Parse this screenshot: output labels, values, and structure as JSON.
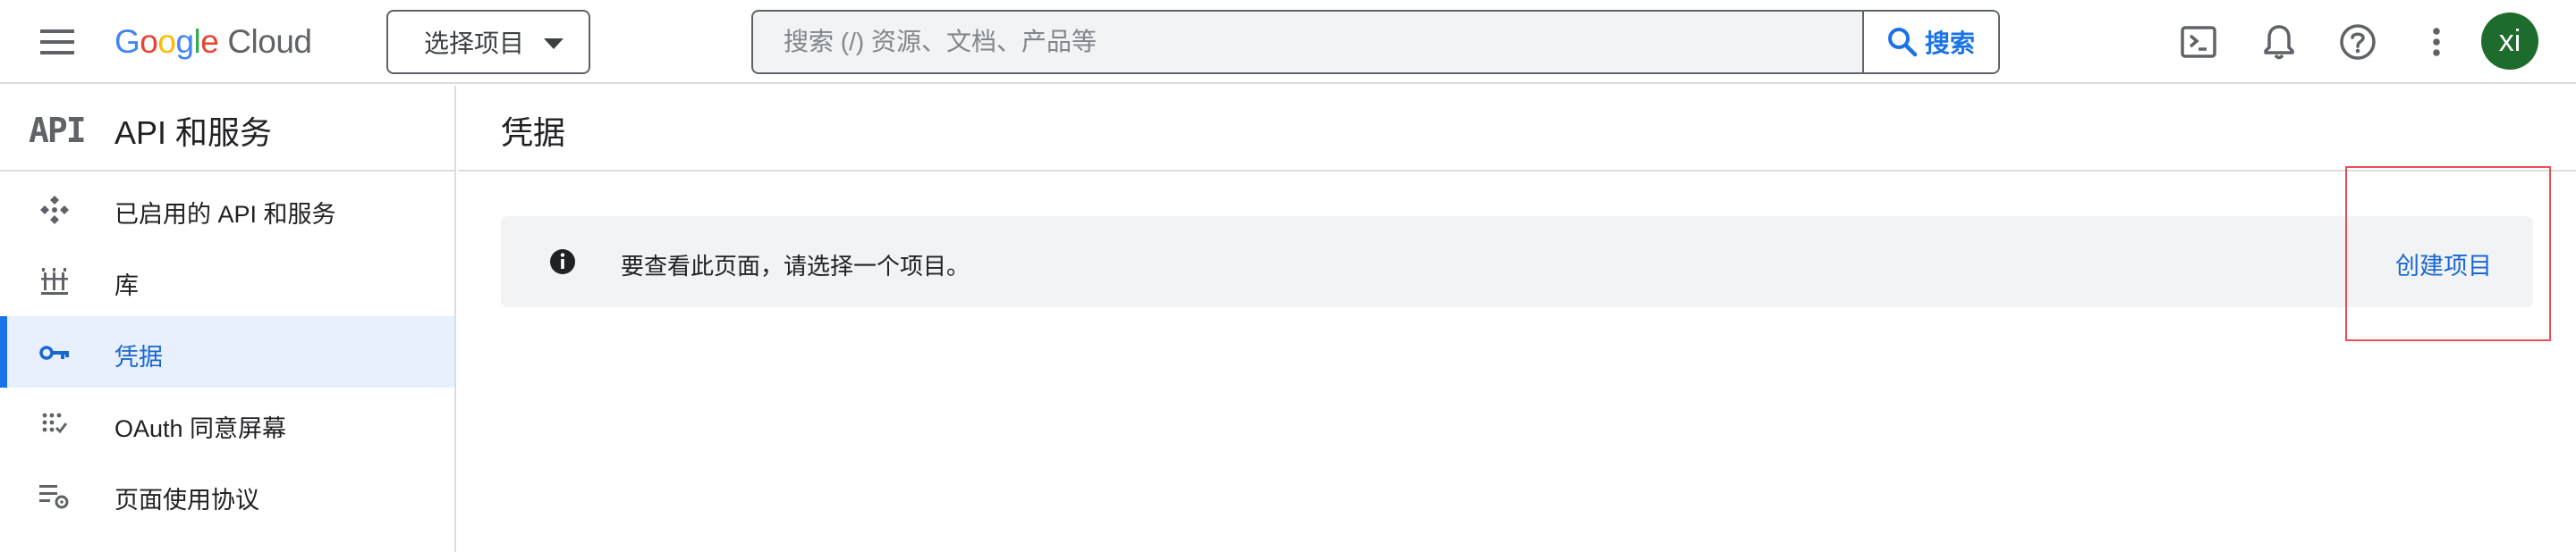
{
  "header": {
    "logo": {
      "g1": "G",
      "o1": "o",
      "o2": "o",
      "g2": "g",
      "l": "l",
      "e": "e",
      "product": "Cloud"
    },
    "project_picker_label": "选择项目",
    "search": {
      "placeholder": "搜索 (/) 资源、文档、产品等",
      "value": "",
      "button_label": "搜索"
    },
    "avatar_initials": "xi"
  },
  "sidebar": {
    "logo_text": "API",
    "title": "API 和服务",
    "items": [
      {
        "label": "已启用的 API 和服务",
        "icon": "api-icon",
        "active": false
      },
      {
        "label": "库",
        "icon": "library-icon",
        "active": false
      },
      {
        "label": "凭据",
        "icon": "key-icon",
        "active": true
      },
      {
        "label": "OAuth 同意屏幕",
        "icon": "oauth-icon",
        "active": false
      },
      {
        "label": "页面使用协议",
        "icon": "settings-list-icon",
        "active": false
      }
    ]
  },
  "main": {
    "title": "凭据",
    "banner": {
      "message": "要查看此页面，请选择一个项目。",
      "action_label": "创建项目"
    }
  },
  "colors": {
    "accent": "#1a73e8",
    "active_bg": "#e8f0fe",
    "avatar_bg": "#1e6b2e",
    "highlight_box": "#ea4f57"
  }
}
